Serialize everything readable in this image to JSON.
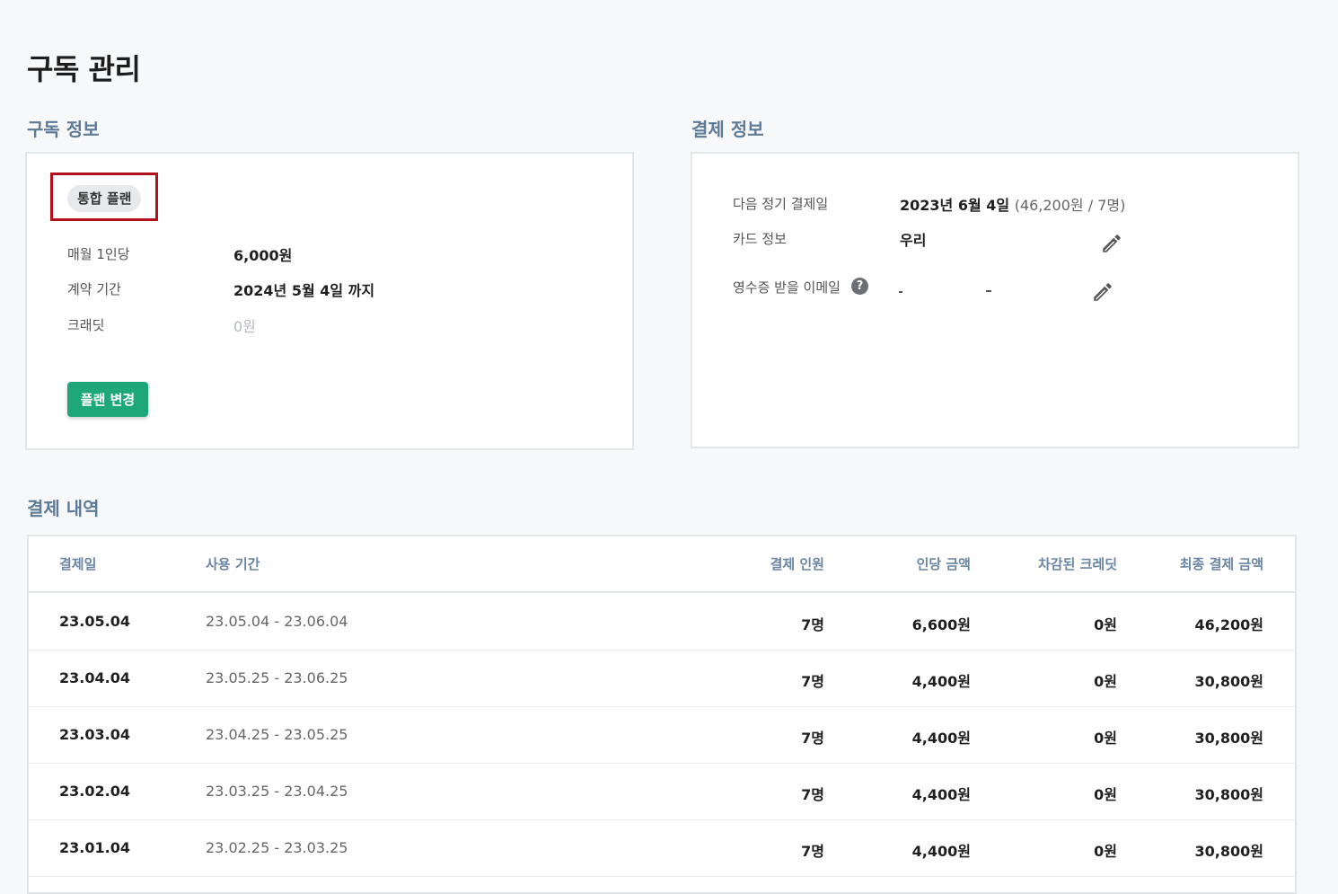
{
  "page": {
    "title": "구독 관리"
  },
  "subscription": {
    "section_title": "구독 정보",
    "plan_badge": "통합 플랜",
    "rows": [
      {
        "label": "매월 1인당",
        "value": "6,000원"
      },
      {
        "label": "계약 기간",
        "value": "2024년 5월 4일 까지"
      },
      {
        "label": "크래딧",
        "value": "0원"
      }
    ],
    "change_button": "플랜 변경"
  },
  "payment": {
    "section_title": "결제 정보",
    "next_label": "다음 정기 결제일",
    "next_value": "2023년 6월 4일",
    "next_sub": "(46,200원 / 7명)",
    "card_label": "카드 정보",
    "card_value": "우리",
    "email_label": "영수증 받을 이메일",
    "help_glyph": "?",
    "edit_icon": "pencil-icon"
  },
  "history": {
    "section_title": "결제 내역",
    "columns": [
      "결제일",
      "사용 기간",
      "결제 인원",
      "인당 금액",
      "차감된 크레딧",
      "최종 결제 금액"
    ],
    "rows": [
      [
        "23.05.04",
        "23.05.04 - 23.06.04",
        "7명",
        "6,600원",
        "0원",
        "46,200원"
      ],
      [
        "23.04.04",
        "23.05.25 - 23.06.25",
        "7명",
        "4,400원",
        "0원",
        "30,800원"
      ],
      [
        "23.03.04",
        "23.04.25 - 23.05.25",
        "7명",
        "4,400원",
        "0원",
        "30,800원"
      ],
      [
        "23.02.04",
        "23.03.25 - 23.04.25",
        "7명",
        "4,400원",
        "0원",
        "30,800원"
      ],
      [
        "23.01.04",
        "23.02.25 - 23.03.25",
        "7명",
        "4,400원",
        "0원",
        "30,800원"
      ]
    ]
  },
  "colors": {
    "accent_green": "#1ea879",
    "section_title": "#5d7a96",
    "highlight_red": "#b2101c"
  }
}
